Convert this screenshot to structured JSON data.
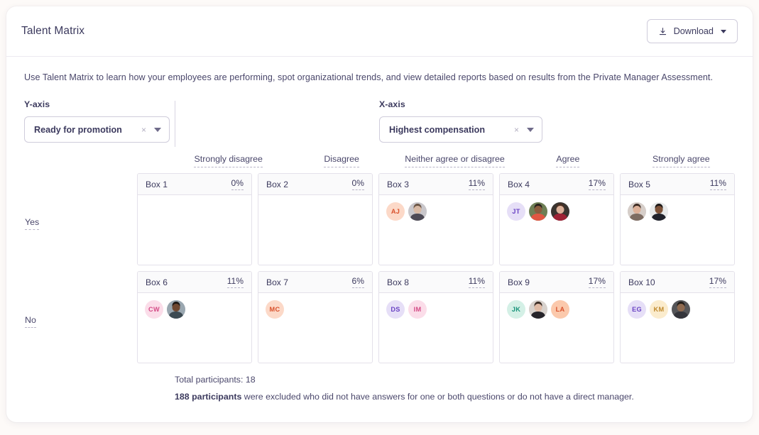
{
  "header": {
    "title": "Talent Matrix",
    "download_label": "Download",
    "download_icon": "download-icon",
    "caret_icon": "chevron-down-icon"
  },
  "description": "Use Talent Matrix to learn how your employees are performing, spot organizational trends, and view detailed reports based on results from the Private Manager Assessment.",
  "axes": {
    "y": {
      "label": "Y-axis",
      "value": "Ready for promotion",
      "clear_icon": "×",
      "caret_icon": "chevron-down-icon"
    },
    "x": {
      "label": "X-axis",
      "value": "Highest compensation",
      "clear_icon": "×",
      "caret_icon": "chevron-down-icon"
    }
  },
  "matrix": {
    "columns": [
      "Strongly disagree",
      "Disagree",
      "Neither agree or disagree",
      "Agree",
      "Strongly agree"
    ],
    "rows": [
      "Yes",
      "No"
    ],
    "boxes": [
      [
        {
          "name": "Box 1",
          "percent": "0%",
          "avatars": []
        },
        {
          "name": "Box 2",
          "percent": "0%",
          "avatars": []
        },
        {
          "name": "Box 3",
          "percent": "11%",
          "avatars": [
            {
              "type": "initials",
              "initials": "AJ",
              "bg": "#fcd9c8",
              "fg": "#d9512c"
            },
            {
              "type": "photo",
              "bg": "#c9c7cb",
              "skin": "#d8b9a4",
              "hair": "#6b5545",
              "shirt": "#4d4a55"
            }
          ]
        },
        {
          "name": "Box 4",
          "percent": "17%",
          "avatars": [
            {
              "type": "initials",
              "initials": "JT",
              "bg": "#e6dff7",
              "fg": "#6a43c4"
            },
            {
              "type": "photo",
              "bg": "#6e7f55",
              "skin": "#8a5c3e",
              "hair": "#27201c",
              "shirt": "#e05642"
            },
            {
              "type": "photo",
              "bg": "#3a3430",
              "skin": "#dcb19a",
              "hair": "#4a2f22",
              "shirt": "#9e2235"
            }
          ]
        }
      ],
      [
        {
          "name": "Box 5",
          "percent": "11%",
          "avatars": [
            {
              "type": "photo",
              "bg": "#d6cec9",
              "skin": "#dcb098",
              "hair": "#3b2a22",
              "shirt": "#7d6c62"
            },
            {
              "type": "photo",
              "bg": "#e8eaea",
              "skin": "#7d5238",
              "hair": "#1b1715",
              "shirt": "#20222b"
            }
          ]
        }
      ],
      [
        {
          "name": "Box 6",
          "percent": "11%",
          "avatars": [
            {
              "type": "initials",
              "initials": "CW",
              "bg": "#fbdde9",
              "fg": "#d44b86"
            },
            {
              "type": "photo",
              "bg": "#9aa7b0",
              "skin": "#6e4730",
              "hair": "#1d1815",
              "shirt": "#3c4a52"
            }
          ]
        },
        {
          "name": "Box 7",
          "percent": "6%",
          "avatars": [
            {
              "type": "initials",
              "initials": "MC",
              "bg": "#fcd9c8",
              "fg": "#d9512c"
            }
          ]
        },
        {
          "name": "Box 8",
          "percent": "11%",
          "avatars": [
            {
              "type": "initials",
              "initials": "DS",
              "bg": "#e6dff7",
              "fg": "#6a43c4"
            },
            {
              "type": "initials",
              "initials": "IM",
              "bg": "#fbdde9",
              "fg": "#d44b86"
            }
          ]
        },
        {
          "name": "Box 9",
          "percent": "17%",
          "avatars": [
            {
              "type": "initials",
              "initials": "JK",
              "bg": "#d4f0e6",
              "fg": "#18937a"
            },
            {
              "type": "photo",
              "bg": "#d8d2cd",
              "skin": "#e0bba6",
              "hair": "#3a2c25",
              "shirt": "#26242a"
            },
            {
              "type": "initials",
              "initials": "LA",
              "bg": "#fbc9ac",
              "fg": "#d9512c"
            }
          ]
        },
        {
          "name": "Box 10",
          "percent": "17%",
          "avatars": [
            {
              "type": "initials",
              "initials": "EG",
              "bg": "#e6dff7",
              "fg": "#6a43c4"
            },
            {
              "type": "initials",
              "initials": "KM",
              "bg": "#fbeccd",
              "fg": "#c08a2e"
            },
            {
              "type": "photo",
              "bg": "#555558",
              "skin": "#8f6a50",
              "hair": "#211c18",
              "shirt": "#34343a"
            }
          ]
        }
      ]
    ]
  },
  "footer": {
    "total_line": "Total participants: 18",
    "excluded_count": "188 participants",
    "excluded_rest": " were excluded who did not have answers for one or both questions or do not have a direct manager."
  }
}
